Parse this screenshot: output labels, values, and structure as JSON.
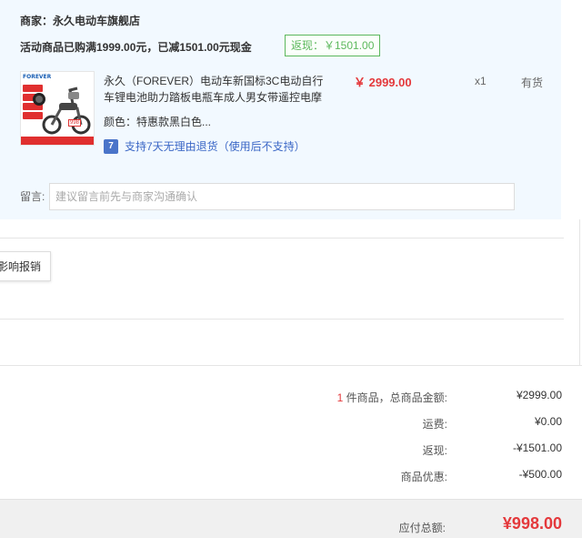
{
  "shop": {
    "merchant": "商家：永久电动车旗舰店",
    "promo": "活动商品已购满1999.00元，已减1501.00元现金",
    "rebate_tag": "返现：￥1501.00"
  },
  "product": {
    "thumb_brand": "FOREVER",
    "thumb_price": "998",
    "title_line1": "永久（FOREVER）电动车新国标3C电动自行",
    "title_line2": "车锂电池助力踏板电瓶车成人男女带遥控电摩",
    "color": "颜色：特惠款黑白色...",
    "return_badge": "7",
    "return_text": "支持7天无理由退货（使用后不支持）",
    "price": "￥ 2999.00",
    "qty": "x1",
    "stock": "有货"
  },
  "message": {
    "label": "留言:",
    "placeholder": "建议留言前先与商家沟通确认"
  },
  "report_button": "影响报销",
  "summary": {
    "item_count": "1",
    "items_label": " 件商品，总商品金额:",
    "items_value": "¥2999.00",
    "shipping_label": "运费:",
    "shipping_value": "¥0.00",
    "rebate_label": "返现:",
    "rebate_value": "-¥1501.00",
    "discount_label": "商品优惠:",
    "discount_value": "-¥500.00"
  },
  "total": {
    "label": "应付总额:",
    "value": "¥998.00"
  },
  "colors": {
    "price_red": "#e4393c",
    "panel_bg": "#f2f9ff",
    "rebate_green": "#5cb85c",
    "link_blue": "#3b67c6"
  }
}
